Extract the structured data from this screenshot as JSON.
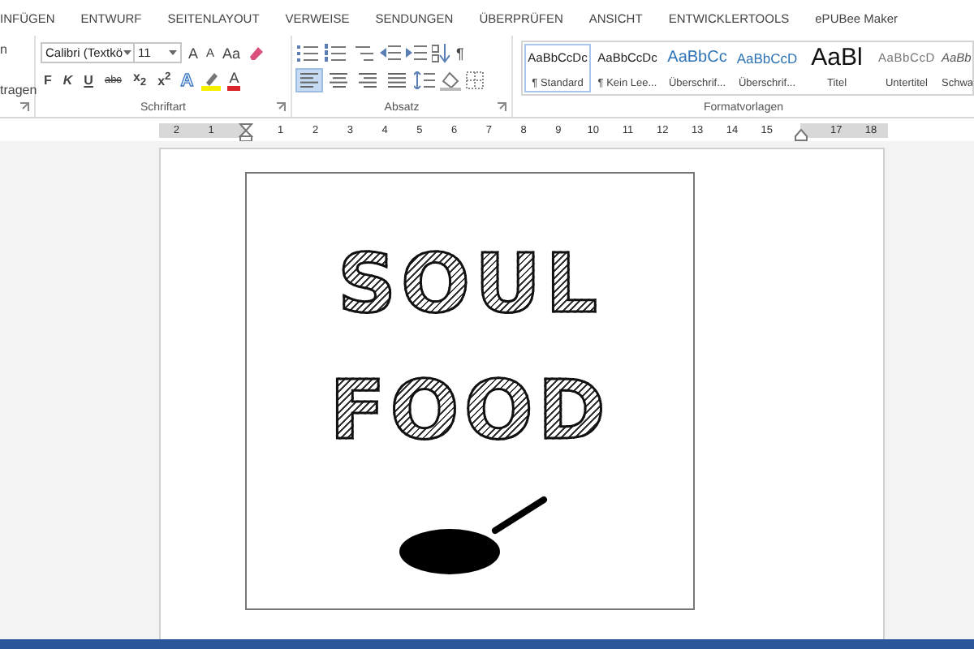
{
  "tabs": [
    {
      "label": "INFÜGEN"
    },
    {
      "label": "ENTWURF"
    },
    {
      "label": "SEITENLAYOUT"
    },
    {
      "label": "VERWEISE"
    },
    {
      "label": "SENDUNGEN"
    },
    {
      "label": "ÜBERPRÜFEN"
    },
    {
      "label": "ANSICHT"
    },
    {
      "label": "ENTWICKLERTOOLS"
    },
    {
      "label": "ePUBee Maker"
    }
  ],
  "clipped_group": {
    "line_1": "n",
    "line_2": "tragen"
  },
  "font": {
    "name": "Calibri (Textkö",
    "size": "11",
    "grow_label": "A",
    "shrink_label": "A",
    "case_label": "Aa",
    "format_buttons": [
      "F",
      "K",
      "U",
      "abc",
      "x$_{2}$",
      "x$^{2}$"
    ],
    "effects_label": "A",
    "color_label": "A",
    "group_label": "Schriftart"
  },
  "paragraph": {
    "pilcrow": "¶",
    "alignments": [
      {
        "selected": true
      },
      {
        "selected": false
      },
      {
        "selected": false
      },
      {
        "selected": false
      }
    ],
    "group_label": "Absatz"
  },
  "styles": {
    "group_label": "Formatvorlagen",
    "items": [
      {
        "preview": "AaBbCcDc",
        "name": "¶ Standard",
        "kind": "normal",
        "selected": true
      },
      {
        "preview": "AaBbCcDc",
        "name": "¶ Kein Lee...",
        "kind": "normal",
        "selected": false
      },
      {
        "preview": "AaBbCc",
        "name": "Überschrif...",
        "kind": "heading1",
        "selected": false
      },
      {
        "preview": "AaBbCcD",
        "name": "Überschrif...",
        "kind": "heading2",
        "selected": false
      },
      {
        "preview": "AaBl",
        "name": "Titel",
        "kind": "title",
        "selected": false
      },
      {
        "preview": "AaBbCcD",
        "name": "Untertitel",
        "kind": "subtitle",
        "selected": false
      },
      {
        "preview": "AaBb",
        "name": "Schwa",
        "kind": "emphasis",
        "selected": false
      }
    ]
  },
  "ruler": {
    "marks": [
      {
        "kind": "number",
        "label": "2"
      },
      {
        "kind": "number",
        "label": "1"
      },
      {
        "kind": "indent"
      },
      {
        "kind": "number",
        "label": "1"
      },
      {
        "kind": "number",
        "label": "2"
      },
      {
        "kind": "number",
        "label": "3"
      },
      {
        "kind": "number",
        "label": "4"
      },
      {
        "kind": "number",
        "label": "5"
      },
      {
        "kind": "number",
        "label": "6"
      },
      {
        "kind": "number",
        "label": "7"
      },
      {
        "kind": "number",
        "label": "8"
      },
      {
        "kind": "number",
        "label": "9"
      },
      {
        "kind": "number",
        "label": "10"
      },
      {
        "kind": "number",
        "label": "11"
      },
      {
        "kind": "number",
        "label": "12"
      },
      {
        "kind": "number",
        "label": "13"
      },
      {
        "kind": "number",
        "label": "14"
      },
      {
        "kind": "number",
        "label": "15"
      },
      {
        "kind": "indent"
      },
      {
        "kind": "number",
        "label": "17"
      },
      {
        "kind": "number",
        "label": "18"
      }
    ]
  },
  "document": {
    "image": {
      "lines": [
        "SOUL",
        "FOOD"
      ]
    }
  }
}
